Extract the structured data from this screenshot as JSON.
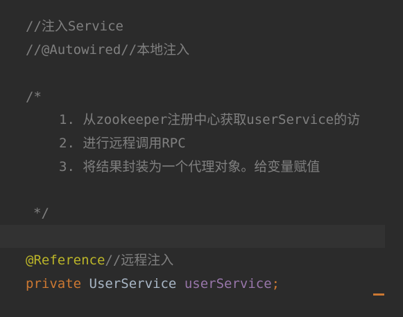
{
  "editor": {
    "lines": [
      {
        "text": "//注入Service"
      },
      {
        "text": "//@Autowired//本地注入"
      },
      {
        "text": "/*"
      },
      {
        "text": "1. 从zookeeper注册中心获取userService的访"
      },
      {
        "text": "2. 进行远程调用RPC"
      },
      {
        "text": "3. 将结果封装为一个代理对象。给变量赋值"
      },
      {
        "text": "*/"
      }
    ],
    "reference_annotation": "@Reference",
    "reference_comment": "//远程注入",
    "field_modifier": "private",
    "field_type": "UserService",
    "field_name": "userService",
    "field_semicolon": ";"
  },
  "colors": {
    "background": "#2b2b2b",
    "comment": "#808080",
    "annotation": "#bbb529",
    "keyword": "#cc7832",
    "type": "#a9b7c6",
    "field": "#9876aa"
  }
}
